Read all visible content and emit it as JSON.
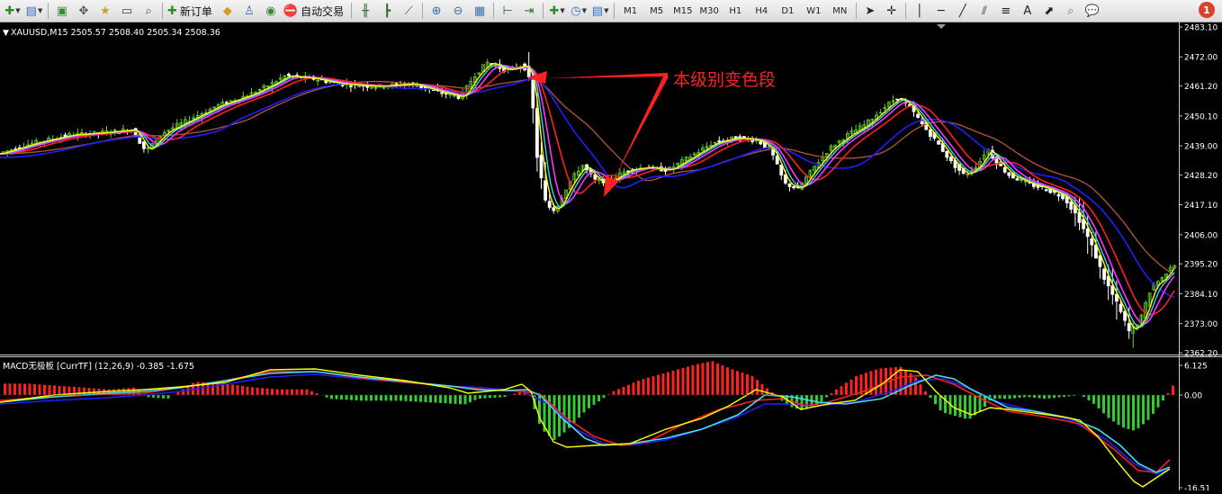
{
  "toolbar": {
    "items": [
      {
        "kind": "icon",
        "name": "new-chart-icon",
        "glyph": "✚",
        "color": "#2e8b2e",
        "caret": true
      },
      {
        "kind": "icon",
        "name": "profiles-icon",
        "glyph": "▤",
        "color": "#3a6fb0",
        "caret": true
      },
      {
        "kind": "sep"
      },
      {
        "kind": "icon",
        "name": "market-watch-icon",
        "glyph": "▣",
        "color": "#3a8a3a"
      },
      {
        "kind": "icon",
        "name": "navigator-icon",
        "glyph": "✥",
        "color": "#555"
      },
      {
        "kind": "icon",
        "name": "favorites-icon",
        "glyph": "★",
        "color": "#c9a227"
      },
      {
        "kind": "icon",
        "name": "terminal-icon",
        "glyph": "▭",
        "color": "#444"
      },
      {
        "kind": "icon",
        "name": "strategy-tester-icon",
        "glyph": "⌕",
        "color": "#555"
      },
      {
        "kind": "sep"
      },
      {
        "kind": "text",
        "name": "new-order-button",
        "icon": "✚",
        "label": "新订单"
      },
      {
        "kind": "icon",
        "name": "metaeditor-icon",
        "glyph": "◆",
        "color": "#d4a017"
      },
      {
        "kind": "icon",
        "name": "signals-icon",
        "glyph": "♙",
        "color": "#3a6fb0"
      },
      {
        "kind": "icon",
        "name": "market-icon",
        "glyph": "◉",
        "color": "#3a8a3a"
      },
      {
        "kind": "text",
        "name": "autotrading-button",
        "icon": "⛔",
        "label": "自动交易"
      },
      {
        "kind": "sep"
      },
      {
        "kind": "icon",
        "name": "bar-chart-icon",
        "glyph": "╫",
        "color": "#2e6e2e"
      },
      {
        "kind": "icon",
        "name": "candles-icon",
        "glyph": "┣",
        "color": "#2e6e2e"
      },
      {
        "kind": "icon",
        "name": "line-chart-icon",
        "glyph": "⟋",
        "color": "#2e6e2e"
      },
      {
        "kind": "sep"
      },
      {
        "kind": "icon",
        "name": "zoom-in-icon",
        "glyph": "⊕",
        "color": "#3a6fb0"
      },
      {
        "kind": "icon",
        "name": "zoom-out-icon",
        "glyph": "⊖",
        "color": "#3a6fb0"
      },
      {
        "kind": "icon",
        "name": "tile-windows-icon",
        "glyph": "▦",
        "color": "#3a6fb0"
      },
      {
        "kind": "sep"
      },
      {
        "kind": "icon",
        "name": "chart-shift-icon",
        "glyph": "⊢",
        "color": "#2e6e2e"
      },
      {
        "kind": "icon",
        "name": "autoscroll-icon",
        "glyph": "⇥",
        "color": "#2e6e2e"
      },
      {
        "kind": "sep"
      },
      {
        "kind": "icon",
        "name": "indicators-icon",
        "glyph": "✚",
        "color": "#2e8b2e",
        "caret": true
      },
      {
        "kind": "icon",
        "name": "periods-icon",
        "glyph": "◷",
        "color": "#3a6fb0",
        "caret": true
      },
      {
        "kind": "icon",
        "name": "templates-icon",
        "glyph": "▤",
        "color": "#3a6fb0",
        "caret": true
      },
      {
        "kind": "sep"
      },
      {
        "kind": "tf",
        "name": "tf-m1",
        "label": "M1"
      },
      {
        "kind": "tf",
        "name": "tf-m5",
        "label": "M5"
      },
      {
        "kind": "tf",
        "name": "tf-m15",
        "label": "M15"
      },
      {
        "kind": "tf",
        "name": "tf-m30",
        "label": "M30"
      },
      {
        "kind": "tf",
        "name": "tf-h1",
        "label": "H1"
      },
      {
        "kind": "tf",
        "name": "tf-h4",
        "label": "H4"
      },
      {
        "kind": "tf",
        "name": "tf-d1",
        "label": "D1"
      },
      {
        "kind": "tf",
        "name": "tf-w1",
        "label": "W1"
      },
      {
        "kind": "tf",
        "name": "tf-mn",
        "label": "MN"
      },
      {
        "kind": "sep"
      },
      {
        "kind": "icon",
        "name": "cursor-icon",
        "glyph": "➤",
        "color": "#222"
      },
      {
        "kind": "icon",
        "name": "crosshair-icon",
        "glyph": "✛",
        "color": "#222"
      },
      {
        "kind": "sep"
      },
      {
        "kind": "icon",
        "name": "vertical-line-icon",
        "glyph": "│",
        "color": "#222"
      },
      {
        "kind": "icon",
        "name": "horizontal-line-icon",
        "glyph": "─",
        "color": "#222"
      },
      {
        "kind": "icon",
        "name": "trendline-icon",
        "glyph": "╱",
        "color": "#222"
      },
      {
        "kind": "icon",
        "name": "equidistant-channel-icon",
        "glyph": "⫽",
        "color": "#222"
      },
      {
        "kind": "icon",
        "name": "fibonacci-icon",
        "glyph": "≡",
        "color": "#222"
      },
      {
        "kind": "icon",
        "name": "text-tool-icon",
        "glyph": "A",
        "color": "#222"
      },
      {
        "kind": "icon",
        "name": "arrow-tool-icon",
        "glyph": "⬈",
        "color": "#222"
      },
      {
        "kind": "icon",
        "name": "search-icon",
        "glyph": "⌕",
        "color": "#3a6fb0"
      },
      {
        "kind": "icon",
        "name": "chat-icon",
        "glyph": "💬",
        "color": "#3a6fb0"
      }
    ],
    "notification_count": "1"
  },
  "main_chart": {
    "header": "XAUUSD,M15  2505.57 2508.40 2505.34 2508.36",
    "annotation": "本级别变色段",
    "price_ticks": [
      "2483.10",
      "2472.00",
      "2461.20",
      "2450.10",
      "2439.00",
      "2428.20",
      "2417.10",
      "2406.00",
      "2395.20",
      "2384.10",
      "2373.00",
      "2362.20"
    ],
    "colors": {
      "bull": "#66cc33",
      "bear": "#ffffff",
      "annotation": "#ff2020",
      "ma_fast": "#ffff00",
      "ma_mid": "#ff2020",
      "ma_slow": "#1f1fff",
      "ma_long": "#b5553b",
      "ma_cyan": "#3fc9ff",
      "ma_magenta": "#ff33ff"
    }
  },
  "macd_panel": {
    "header": "MACD无极板 [CurrTF] (12,26,9) -0.385 -1.675",
    "ticks": [
      "6.125",
      "0.00",
      "-16.51"
    ],
    "colors": {
      "hist_pos": "#ff2020",
      "hist_neg": "#33cc33",
      "line_yellow": "#ffff00",
      "line_cyan": "#44ddee",
      "line_red": "#ff2020",
      "line_blue": "#1f1fff"
    }
  }
}
